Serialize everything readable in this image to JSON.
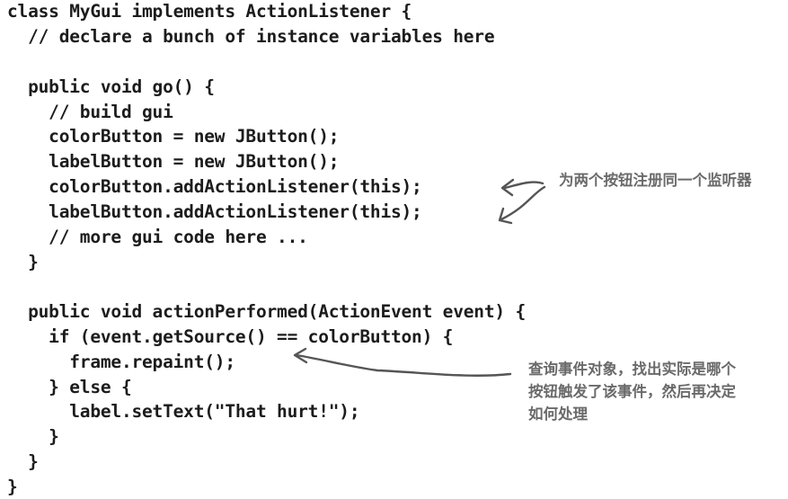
{
  "code_lines": [
    "class MyGui implements ActionListener {",
    "  // declare a bunch of instance variables here",
    "  public void go() {",
    "    // build gui",
    "    colorButton = new JButton();",
    "    labelButton = new JButton();",
    "    colorButton.addActionListener(this);",
    "    labelButton.addActionListener(this);",
    "    // more gui code here ...",
    "  }",
    "  public void actionPerformed(ActionEvent event) {",
    "    if (event.getSource() == colorButton) {",
    "      frame.repaint();",
    "    } else {",
    "      label.setText(\"That hurt!\");",
    "    }",
    "  }",
    "}"
  ],
  "annotations": {
    "register_note": "为两个按钮注册同一个监听器",
    "query_note": [
      "查询事件对象，找出实际是哪个",
      "按钮触发了该事件，然后再决定",
      "如何处理"
    ]
  }
}
